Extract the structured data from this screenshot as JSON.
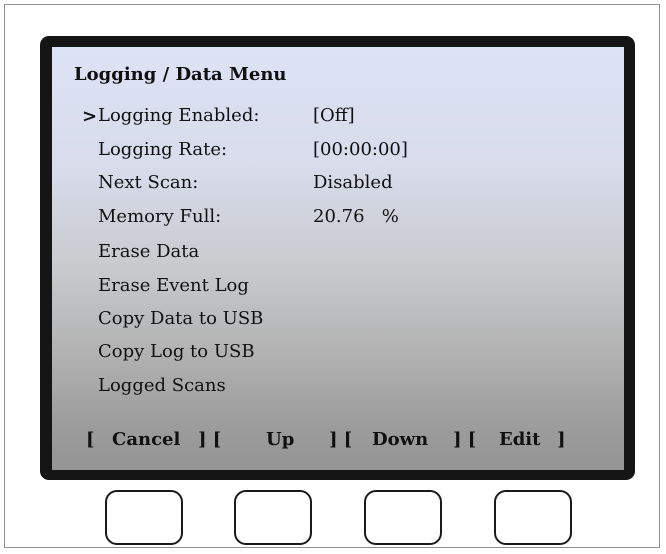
{
  "screen": {
    "title": "Logging / Data Menu",
    "cursor": ">",
    "items": [
      {
        "label": "Logging Enabled:",
        "value": "[Off]"
      },
      {
        "label": "Logging Rate:",
        "value": "[00:00:00]"
      },
      {
        "label": "Next Scan:",
        "value": "Disabled"
      },
      {
        "label": "Memory Full:",
        "value": "20.76   %"
      },
      {
        "label": "Erase Data",
        "value": ""
      },
      {
        "label": "Erase Event Log",
        "value": ""
      },
      {
        "label": "Copy Data to USB",
        "value": ""
      },
      {
        "label": "Copy Log to USB",
        "value": ""
      },
      {
        "label": "Logged Scans",
        "value": ""
      }
    ]
  },
  "softkeys": {
    "open_bracket": "[",
    "separator": "] [",
    "close_bracket": "]",
    "cancel": "Cancel",
    "up": "Up",
    "down": "Down",
    "edit": "Edit"
  }
}
